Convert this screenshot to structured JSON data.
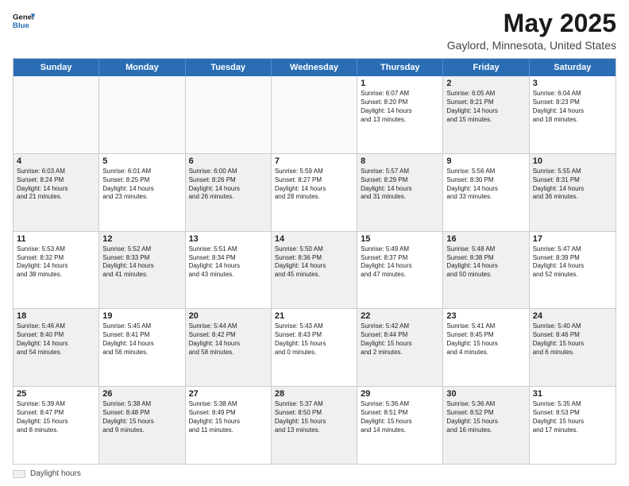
{
  "logo": {
    "line1": "General",
    "line2": "Blue"
  },
  "title": "May 2025",
  "subtitle": "Gaylord, Minnesota, United States",
  "weekdays": [
    "Sunday",
    "Monday",
    "Tuesday",
    "Wednesday",
    "Thursday",
    "Friday",
    "Saturday"
  ],
  "legend_label": "Daylight hours",
  "rows": [
    [
      {
        "day": "",
        "text": "",
        "empty": true
      },
      {
        "day": "",
        "text": "",
        "empty": true
      },
      {
        "day": "",
        "text": "",
        "empty": true
      },
      {
        "day": "",
        "text": "",
        "empty": true
      },
      {
        "day": "1",
        "text": "Sunrise: 6:07 AM\nSunset: 8:20 PM\nDaylight: 14 hours\nand 13 minutes.",
        "empty": false
      },
      {
        "day": "2",
        "text": "Sunrise: 6:05 AM\nSunset: 8:21 PM\nDaylight: 14 hours\nand 15 minutes.",
        "empty": false,
        "alt": true
      },
      {
        "day": "3",
        "text": "Sunrise: 6:04 AM\nSunset: 8:23 PM\nDaylight: 14 hours\nand 18 minutes.",
        "empty": false
      }
    ],
    [
      {
        "day": "4",
        "text": "Sunrise: 6:03 AM\nSunset: 8:24 PM\nDaylight: 14 hours\nand 21 minutes.",
        "empty": false,
        "alt": true
      },
      {
        "day": "5",
        "text": "Sunrise: 6:01 AM\nSunset: 8:25 PM\nDaylight: 14 hours\nand 23 minutes.",
        "empty": false
      },
      {
        "day": "6",
        "text": "Sunrise: 6:00 AM\nSunset: 8:26 PM\nDaylight: 14 hours\nand 26 minutes.",
        "empty": false,
        "alt": true
      },
      {
        "day": "7",
        "text": "Sunrise: 5:59 AM\nSunset: 8:27 PM\nDaylight: 14 hours\nand 28 minutes.",
        "empty": false
      },
      {
        "day": "8",
        "text": "Sunrise: 5:57 AM\nSunset: 8:29 PM\nDaylight: 14 hours\nand 31 minutes.",
        "empty": false,
        "alt": true
      },
      {
        "day": "9",
        "text": "Sunrise: 5:56 AM\nSunset: 8:30 PM\nDaylight: 14 hours\nand 33 minutes.",
        "empty": false
      },
      {
        "day": "10",
        "text": "Sunrise: 5:55 AM\nSunset: 8:31 PM\nDaylight: 14 hours\nand 36 minutes.",
        "empty": false,
        "alt": true
      }
    ],
    [
      {
        "day": "11",
        "text": "Sunrise: 5:53 AM\nSunset: 8:32 PM\nDaylight: 14 hours\nand 38 minutes.",
        "empty": false
      },
      {
        "day": "12",
        "text": "Sunrise: 5:52 AM\nSunset: 8:33 PM\nDaylight: 14 hours\nand 41 minutes.",
        "empty": false,
        "alt": true
      },
      {
        "day": "13",
        "text": "Sunrise: 5:51 AM\nSunset: 8:34 PM\nDaylight: 14 hours\nand 43 minutes.",
        "empty": false
      },
      {
        "day": "14",
        "text": "Sunrise: 5:50 AM\nSunset: 8:36 PM\nDaylight: 14 hours\nand 45 minutes.",
        "empty": false,
        "alt": true
      },
      {
        "day": "15",
        "text": "Sunrise: 5:49 AM\nSunset: 8:37 PM\nDaylight: 14 hours\nand 47 minutes.",
        "empty": false
      },
      {
        "day": "16",
        "text": "Sunrise: 5:48 AM\nSunset: 8:38 PM\nDaylight: 14 hours\nand 50 minutes.",
        "empty": false,
        "alt": true
      },
      {
        "day": "17",
        "text": "Sunrise: 5:47 AM\nSunset: 8:39 PM\nDaylight: 14 hours\nand 52 minutes.",
        "empty": false
      }
    ],
    [
      {
        "day": "18",
        "text": "Sunrise: 5:46 AM\nSunset: 8:40 PM\nDaylight: 14 hours\nand 54 minutes.",
        "empty": false,
        "alt": true
      },
      {
        "day": "19",
        "text": "Sunrise: 5:45 AM\nSunset: 8:41 PM\nDaylight: 14 hours\nand 56 minutes.",
        "empty": false
      },
      {
        "day": "20",
        "text": "Sunrise: 5:44 AM\nSunset: 8:42 PM\nDaylight: 14 hours\nand 58 minutes.",
        "empty": false,
        "alt": true
      },
      {
        "day": "21",
        "text": "Sunrise: 5:43 AM\nSunset: 8:43 PM\nDaylight: 15 hours\nand 0 minutes.",
        "empty": false
      },
      {
        "day": "22",
        "text": "Sunrise: 5:42 AM\nSunset: 8:44 PM\nDaylight: 15 hours\nand 2 minutes.",
        "empty": false,
        "alt": true
      },
      {
        "day": "23",
        "text": "Sunrise: 5:41 AM\nSunset: 8:45 PM\nDaylight: 15 hours\nand 4 minutes.",
        "empty": false
      },
      {
        "day": "24",
        "text": "Sunrise: 5:40 AM\nSunset: 8:46 PM\nDaylight: 15 hours\nand 6 minutes.",
        "empty": false,
        "alt": true
      }
    ],
    [
      {
        "day": "25",
        "text": "Sunrise: 5:39 AM\nSunset: 8:47 PM\nDaylight: 15 hours\nand 8 minutes.",
        "empty": false
      },
      {
        "day": "26",
        "text": "Sunrise: 5:38 AM\nSunset: 8:48 PM\nDaylight: 15 hours\nand 9 minutes.",
        "empty": false,
        "alt": true
      },
      {
        "day": "27",
        "text": "Sunrise: 5:38 AM\nSunset: 8:49 PM\nDaylight: 15 hours\nand 11 minutes.",
        "empty": false
      },
      {
        "day": "28",
        "text": "Sunrise: 5:37 AM\nSunset: 8:50 PM\nDaylight: 15 hours\nand 13 minutes.",
        "empty": false,
        "alt": true
      },
      {
        "day": "29",
        "text": "Sunrise: 5:36 AM\nSunset: 8:51 PM\nDaylight: 15 hours\nand 14 minutes.",
        "empty": false
      },
      {
        "day": "30",
        "text": "Sunrise: 5:36 AM\nSunset: 8:52 PM\nDaylight: 15 hours\nand 16 minutes.",
        "empty": false,
        "alt": true
      },
      {
        "day": "31",
        "text": "Sunrise: 5:35 AM\nSunset: 8:53 PM\nDaylight: 15 hours\nand 17 minutes.",
        "empty": false
      }
    ]
  ]
}
